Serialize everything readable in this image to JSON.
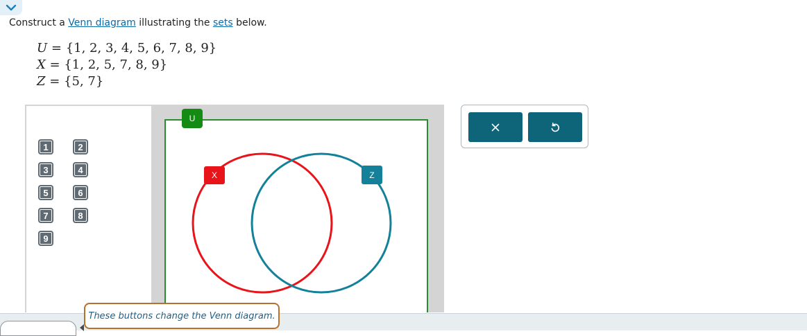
{
  "instruction": {
    "prefix": "Construct a ",
    "link1": "Venn diagram",
    "middle": " illustrating the ",
    "link2": "sets",
    "suffix": " below."
  },
  "sets": [
    {
      "var": "U",
      "members": "{1, 2, 3, 4, 5, 6, 7, 8, 9}"
    },
    {
      "var": "X",
      "members": "{1, 2, 5, 7, 8, 9}"
    },
    {
      "var": "Z",
      "members": "{5, 7}"
    }
  ],
  "palette": {
    "left_column": [
      "1",
      "3",
      "5",
      "7",
      "9"
    ],
    "right_column": [
      "2",
      "4",
      "6",
      "8"
    ]
  },
  "diagram": {
    "universe_label": "U",
    "set_x_label": "X",
    "set_z_label": "Z",
    "colors": {
      "universe": "#148c14",
      "set_x": "#e8141a",
      "set_z": "#128199"
    }
  },
  "toolbar": {
    "clear_icon": "close-icon",
    "reset_icon": "undo-icon"
  },
  "tooltip": {
    "text": "These buttons change the Venn diagram."
  }
}
